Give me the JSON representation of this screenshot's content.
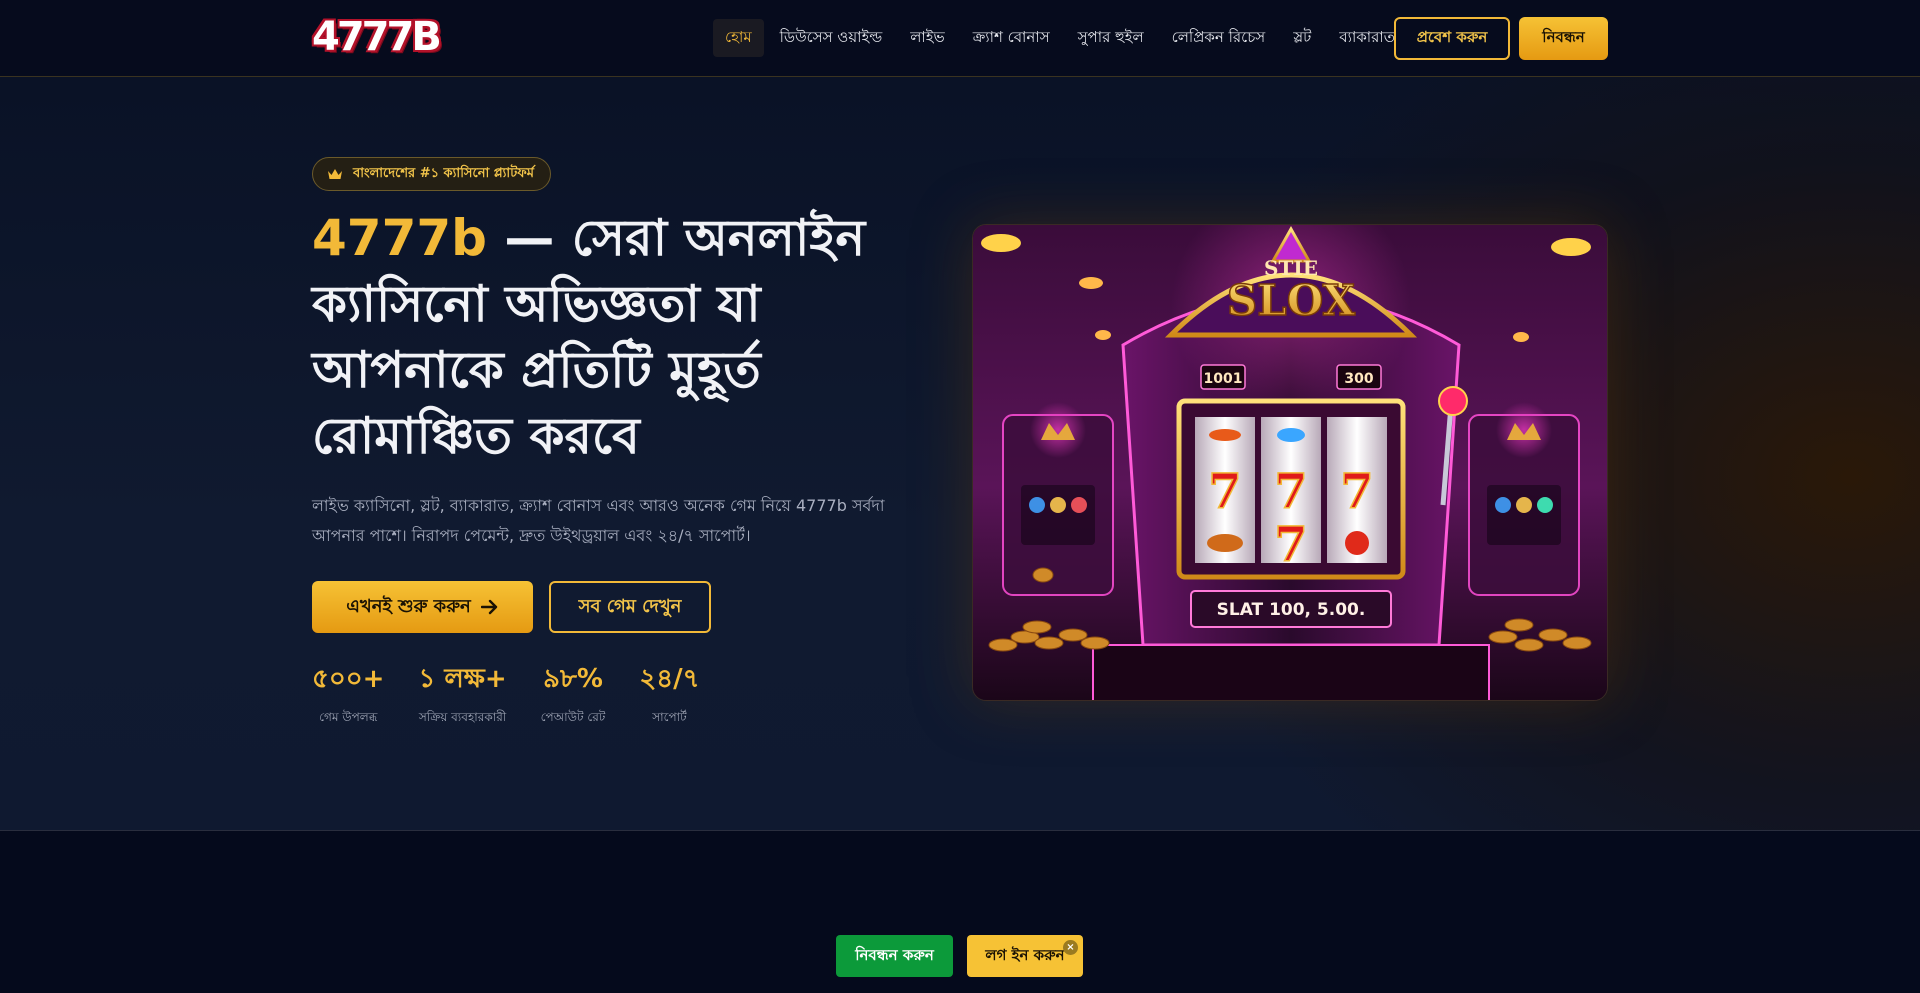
{
  "header": {
    "logo_text": "4777B",
    "nav": [
      {
        "label": "হোম",
        "active": true
      },
      {
        "label": "ডিউসেস ওয়াইল্ড",
        "active": false
      },
      {
        "label": "লাইভ",
        "active": false
      },
      {
        "label": "ক্র্যাশ বোনাস",
        "active": false
      },
      {
        "label": "সুপার হুইল",
        "active": false
      },
      {
        "label": "লেপ্রিকন রিচেস",
        "active": false
      },
      {
        "label": "স্লট",
        "active": false
      },
      {
        "label": "ব্যাকারাত",
        "active": false
      }
    ],
    "login_label": "প্রবেশ করুন",
    "register_label": "নিবন্ধন"
  },
  "hero": {
    "badge": "বাংলাদেশের #১ ক্যাসিনো প্ল্যাটফর্ম",
    "title_accent": "4777b",
    "title_rest": " — সেরা অনলাইন ক্যাসিনো অভিজ্ঞতা যা আপনাকে প্রতিটি মুহূর্ত রোমাঞ্চিত করবে",
    "subtitle": "লাইভ ক্যাসিনো, স্লট, ব্যাকারাত, ক্র্যাশ বোনাস এবং আরও অনেক গেম নিয়ে 4777b সর্বদা আপনার পাশে। নিরাপদ পেমেন্ট, দ্রুত উইথড্রয়াল এবং ২৪/৭ সাপোর্ট।",
    "cta_primary": "এখনই শুরু করুন",
    "cta_secondary": "সব গেম দেখুন",
    "stats": [
      {
        "value": "৫০০+",
        "label": "গেম উপলব্ধ"
      },
      {
        "value": "১ লক্ষ+",
        "label": "সক্রিয় ব্যবহারকারী"
      },
      {
        "value": "৯৮%",
        "label": "পেআউট রেট"
      },
      {
        "value": "২৪/৭",
        "label": "সাপোর্ট"
      }
    ],
    "image": {
      "top_text": "STIE",
      "brand_text": "SLOX",
      "counter_left": "1001",
      "counter_right": "300",
      "plate_text": "SLAT 100, 5.00."
    }
  },
  "floating": {
    "register_label": "নিবন্ধন করুন",
    "login_label": "লগ ইন করুন",
    "close_glyph": "×"
  },
  "colors": {
    "accent": "#f2b938",
    "green": "#0c9a3a",
    "background": "#050a1c"
  }
}
